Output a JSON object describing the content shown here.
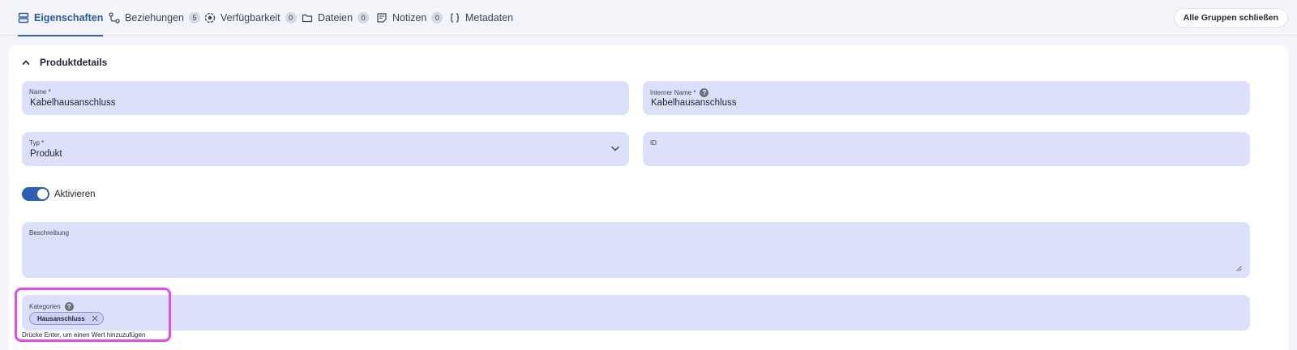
{
  "tabs": [
    {
      "label": "Eigenschaften",
      "icon": "properties-icon",
      "active": true
    },
    {
      "label": "Beziehungen",
      "icon": "relations-icon",
      "count": "5"
    },
    {
      "label": "Verfügbarkeit",
      "icon": "availability-icon",
      "count": "0"
    },
    {
      "label": "Dateien",
      "icon": "folder-icon",
      "count": "0"
    },
    {
      "label": "Notizen",
      "icon": "notes-icon",
      "count": "0"
    },
    {
      "label": "Metadaten",
      "icon": "braces-icon"
    }
  ],
  "header": {
    "close_groups_label": "Alle Gruppen schließen"
  },
  "section": {
    "title": "Produktdetails",
    "expanded": true
  },
  "fields": {
    "name": {
      "label": "Name *",
      "value": "Kabelhausanschluss"
    },
    "internal_name": {
      "label": "Interner Name *",
      "value": "Kabelhausanschluss"
    },
    "type": {
      "label": "Typ *",
      "value": "Produkt"
    },
    "id": {
      "label": "ID",
      "value": ""
    },
    "activate": {
      "label": "Aktivieren",
      "checked": true
    },
    "description": {
      "label": "Beschreibung",
      "value": ""
    },
    "categories": {
      "label": "Kategorien",
      "chips": [
        "Hausanschluss"
      ],
      "hint": "Drücke Enter, um einen Wert hinzuzufügen"
    }
  },
  "colors": {
    "accent": "#2f5fb3",
    "field_bg": "#dce0fa",
    "highlight": "#e14ee0"
  }
}
